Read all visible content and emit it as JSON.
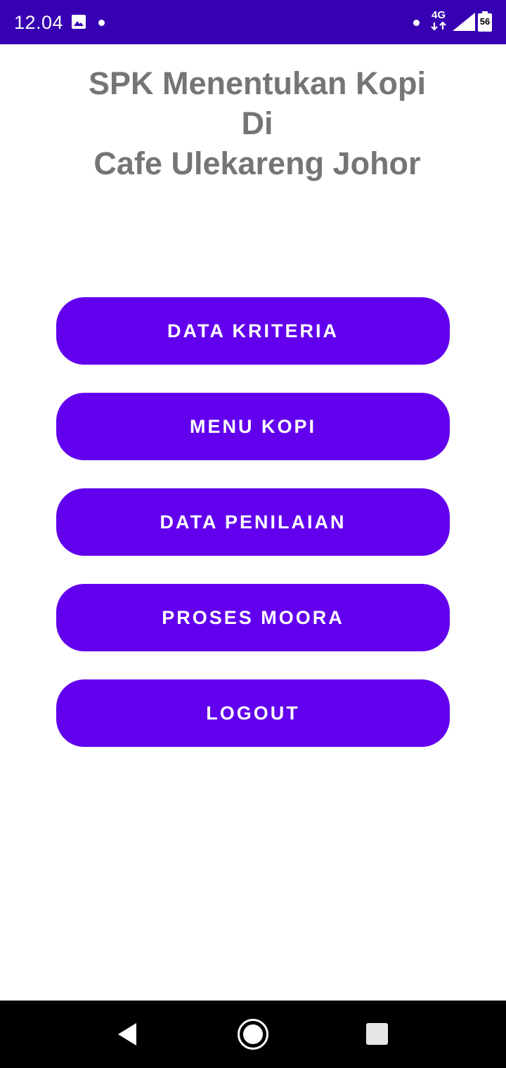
{
  "status_bar": {
    "time": "12.04",
    "network": "4G",
    "battery_level": "56",
    "icons": [
      "image-icon",
      "notification-dot",
      "network-4g-icon",
      "signal-icon",
      "battery-icon"
    ],
    "background_color": "#3700b3"
  },
  "header": {
    "title_lines": [
      "SPK Menentukan Kopi",
      "Di",
      "Cafe Ulekareng Johor"
    ]
  },
  "menu": {
    "buttons": [
      {
        "label": "DATA KRITERIA"
      },
      {
        "label": "MENU KOPI"
      },
      {
        "label": "DATA PENILAIAN"
      },
      {
        "label": "PROSES MOORA"
      },
      {
        "label": "LOGOUT"
      }
    ],
    "button_color": "#6200ee"
  },
  "nav_bar": {
    "icons": [
      "back-icon",
      "home-icon",
      "recents-icon"
    ]
  }
}
